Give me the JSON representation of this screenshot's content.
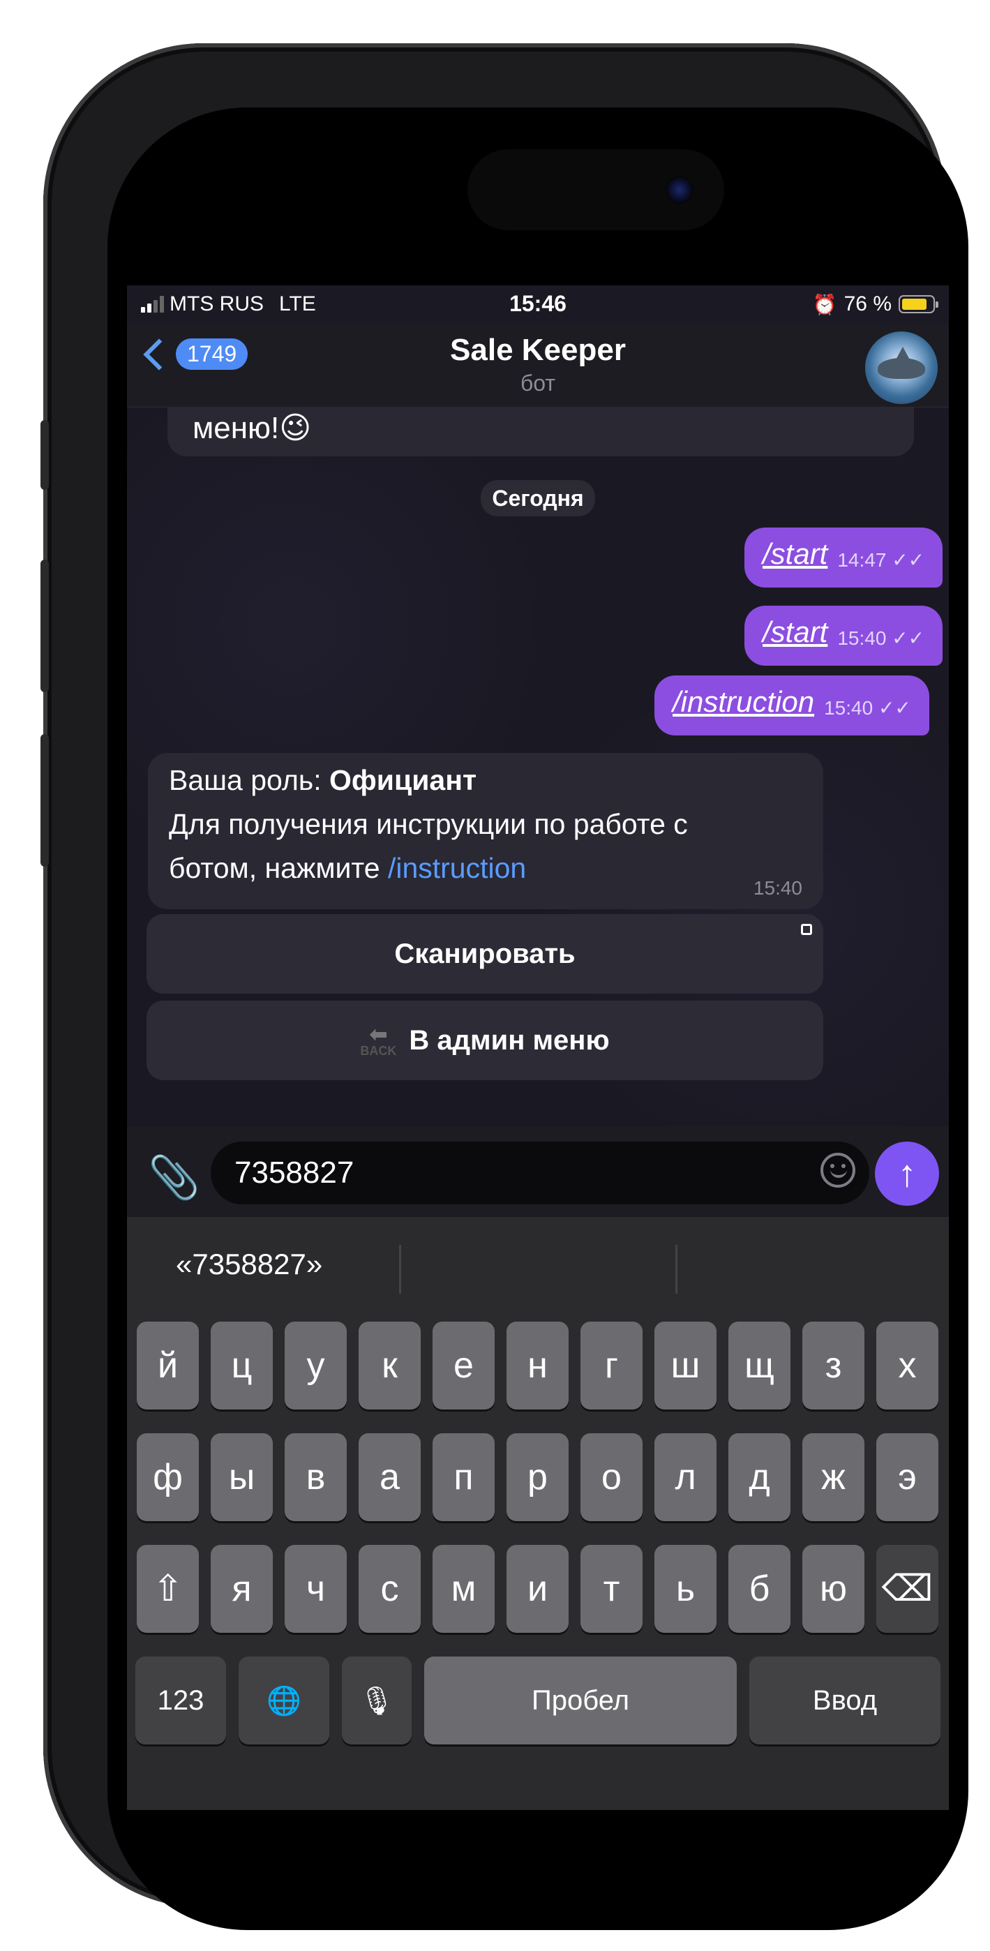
{
  "status_bar": {
    "carrier": "MTS RUS",
    "network": "LTE",
    "time": "15:46",
    "battery_percent": "76 %",
    "battery_level": 0.76
  },
  "header": {
    "back_badge": "1749",
    "title": "Sale Keeper",
    "subtitle": "бот"
  },
  "chat": {
    "previous_message_tail": "меню!😉",
    "date_separator": "Сегодня",
    "outgoing": [
      {
        "text": "/start",
        "time": "14:47"
      },
      {
        "text": "/start",
        "time": "15:40"
      },
      {
        "text": "/instruction",
        "time": "15:40"
      }
    ],
    "incoming": {
      "role_label": "Ваша роль: ",
      "role_value": "Официант",
      "line2": "Для получения инструкции по работе с",
      "line3_prefix": "ботом, нажмите ",
      "line3_link": "/instruction",
      "time": "15:40"
    },
    "buttons": {
      "scan": "Сканировать",
      "admin_menu": "В админ меню",
      "back_icon_text": "BACK"
    }
  },
  "input": {
    "value": "7358827",
    "icons": [
      "paperclip-icon",
      "smiley-icon",
      "send-arrow-icon"
    ]
  },
  "keyboard": {
    "suggestion": "«7358827»",
    "row1": [
      "й",
      "ц",
      "у",
      "к",
      "е",
      "н",
      "г",
      "ш",
      "щ",
      "з",
      "х"
    ],
    "row2": [
      "ф",
      "ы",
      "в",
      "а",
      "п",
      "р",
      "о",
      "л",
      "д",
      "ж",
      "э"
    ],
    "row3": [
      "я",
      "ч",
      "с",
      "м",
      "и",
      "т",
      "ь",
      "б",
      "ю"
    ],
    "numbers_key": "123",
    "space_key": "Пробел",
    "return_key": "Ввод",
    "icons": [
      "shift-icon",
      "backspace-icon",
      "globe-icon",
      "microphone-icon"
    ]
  },
  "colors": {
    "accent_outgoing": "#8c4ee0",
    "link": "#5a9cff",
    "badge": "#4f8bf5",
    "send": "#7e55f2"
  }
}
